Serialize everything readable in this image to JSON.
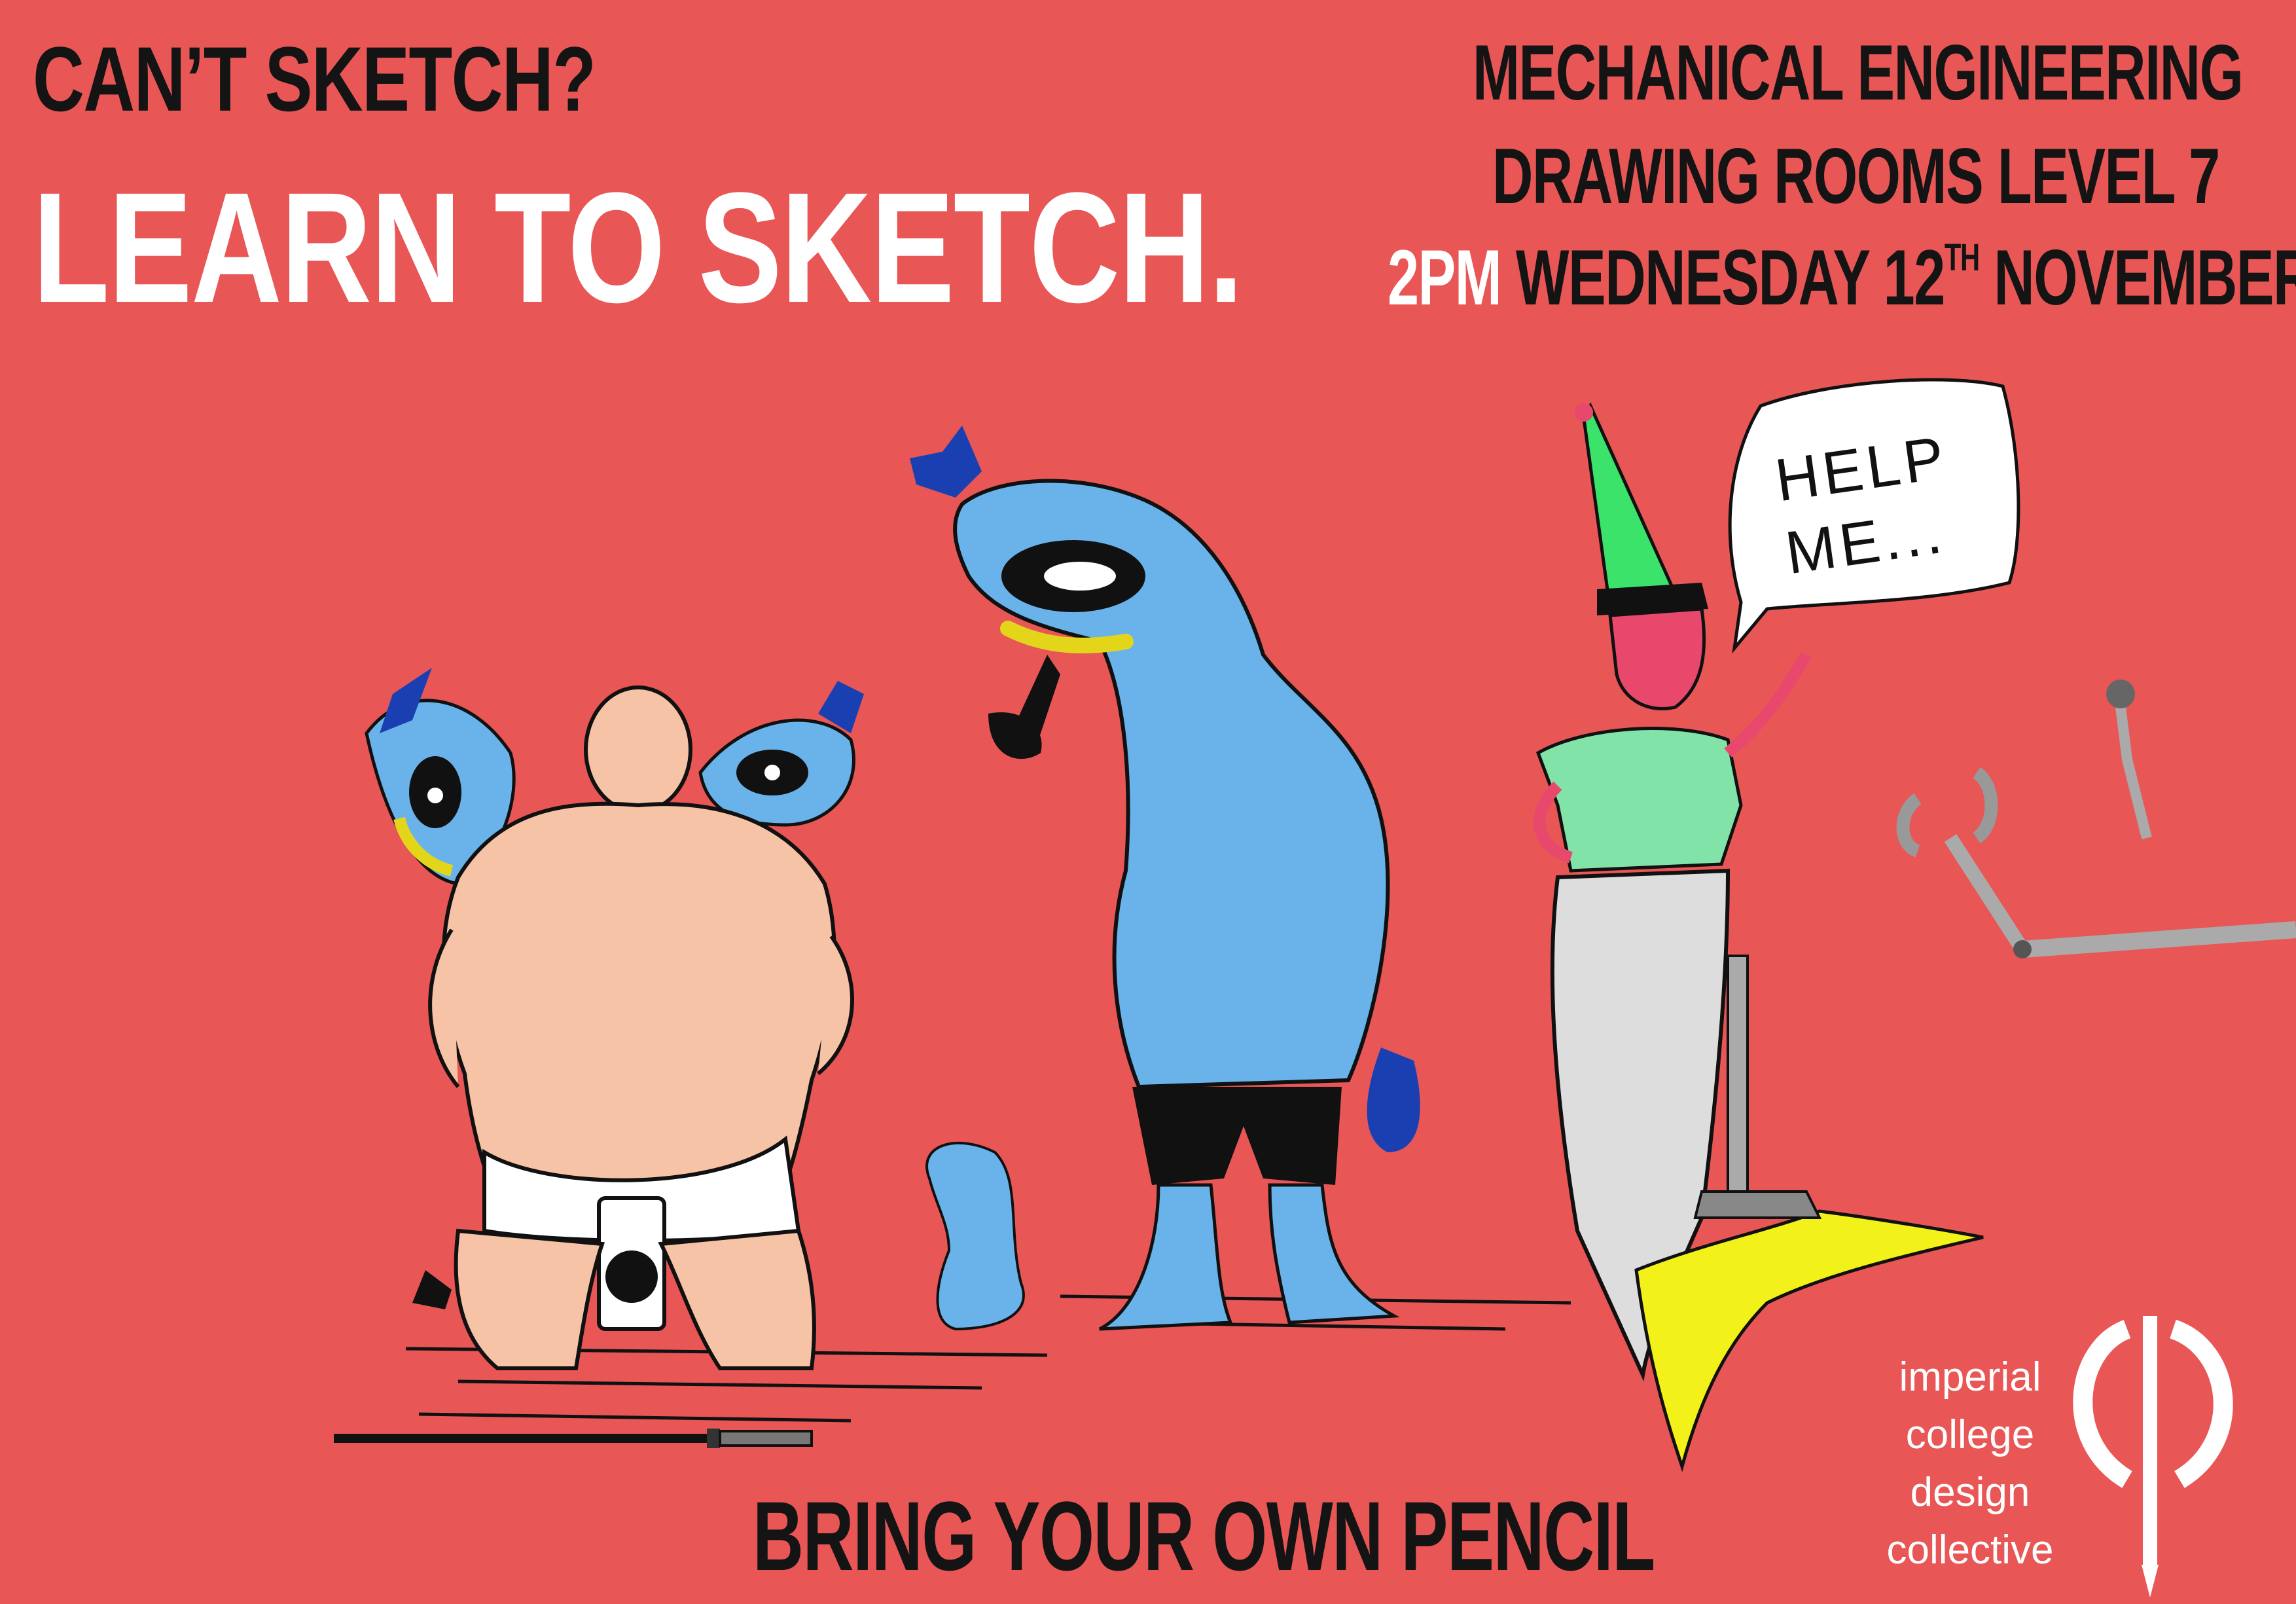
{
  "poster": {
    "background_color": "#e85656",
    "heading_top": "CAN’T SKETCH?",
    "heading_main": "LEARN TO SKETCH.",
    "info_line_1": "MECHANICAL ENGINEERING",
    "info_line_2": "DRAWING ROOMS LEVEL 7",
    "info_time": "2PM",
    "info_day": "WEDNESDAY 12",
    "info_ordinal": "TH",
    "info_month": "NOVEMBER",
    "footer": "BRING YOUR OWN PENCIL",
    "speech_bubble_line_1": "HELP",
    "speech_bubble_line_2": "ME...",
    "logo_lines": [
      "imperial",
      "college",
      "design",
      "collective"
    ]
  },
  "illustration": {
    "characters": [
      "sumo-wrestler",
      "blue-creature",
      "two-blue-bird-heads",
      "small-blue-blob",
      "mermaid-elf",
      "robot-arm",
      "katana"
    ],
    "colors": {
      "skin": "#f7c3a6",
      "creature_blue": "#69b3ea",
      "dark_blue": "#1a3fb0",
      "elf_hat": "#3ce36a",
      "elf_shirt": "#82e3a8",
      "tail_yellow": "#f2f21a",
      "elf_face": "#e8486c"
    }
  }
}
